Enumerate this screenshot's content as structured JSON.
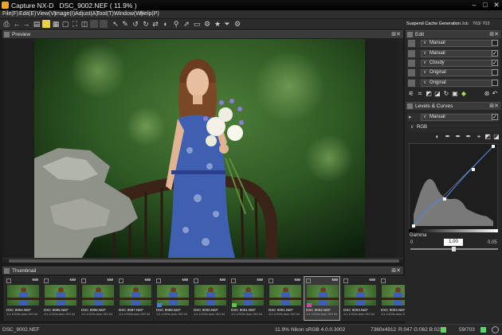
{
  "app": {
    "name": "Capture NX-D",
    "file_title": "DSC_9002.NEF ( 11.9% )"
  },
  "menu": [
    "File(F)",
    "Edit(E)",
    "View(V)",
    "Image(I)",
    "Adjust(A)",
    "Tool(T)",
    "Window(W)",
    "Help(P)"
  ],
  "job_tabs": {
    "active": "Suspend Cache Generation",
    "job": "Job",
    "count": "703/ 703"
  },
  "panels": {
    "preview": "Preview",
    "thumbnail": "Thumbnail",
    "edit": "Edit",
    "levels": "Levels & Curves"
  },
  "edit_rows": [
    {
      "icon": "picture-control-icon",
      "value": "Manual",
      "checked": false
    },
    {
      "icon": "exposure-icon",
      "value": "Manual",
      "checked": true
    },
    {
      "icon": "white-balance-icon",
      "value": "Cloudy",
      "checked": true
    },
    {
      "icon": "tone-icon",
      "value": "Original",
      "checked": false
    },
    {
      "icon": "lens-icon",
      "value": "Original",
      "checked": false
    }
  ],
  "levels": {
    "mode": "Manual",
    "channel": "RGB",
    "gamma_label": "Gamma",
    "gamma_value": "1.00",
    "black_point": "0",
    "white_point": "0.05"
  },
  "thumbnails": [
    {
      "name": "DSC 8994.NEF",
      "info": "1/1:1/320s Auto ISO 64",
      "label": "",
      "selected": false
    },
    {
      "name": "DSC 8995.NEF",
      "info": "1/1:1/320s Auto ISO 64",
      "label": "",
      "selected": false
    },
    {
      "name": "DSC 8996.NEF",
      "info": "1/1:1/320s Auto ISO 64",
      "label": "",
      "selected": false
    },
    {
      "name": "DSC 8997.NEF",
      "info": "1/1:1/320s Auto ISO 64",
      "label": "",
      "selected": false
    },
    {
      "name": "DSC 8998.NEF",
      "info": "1/1:1/320s Auto ISO 64",
      "label": "#4a7fd1",
      "selected": false
    },
    {
      "name": "DSC 9000.NEF",
      "info": "1/1:1/320s Auto ISO 64",
      "label": "",
      "selected": false
    },
    {
      "name": "DSC 9001.NEF",
      "info": "1/1:1/320s Auto ISO 64",
      "label": "#62c23b",
      "selected": false
    },
    {
      "name": "DSC 9001.NEF",
      "info": "1/1:1/320s Auto ISO 64",
      "label": "",
      "selected": false
    },
    {
      "name": "DSC 9002.NEF",
      "info": "1/1:1/320s Auto ISO 64",
      "label": "#d24aa0",
      "selected": true
    },
    {
      "name": "DSC 9003.NEF",
      "info": "1/1:1/320s Auto ISO 64",
      "label": "",
      "selected": false
    },
    {
      "name": "DSC 9004.NEF",
      "info": "1/1:1/320s Auto ISO 64",
      "label": "",
      "selected": false
    }
  ],
  "status": {
    "filename": "DSC_9002.NEF",
    "zoom": "11.9%",
    "profile": "Nikon sRGB 4.0.0.3002",
    "dimensions": "7360x4912",
    "rgb": "R:047 G:062 B:023",
    "page": "59/703"
  },
  "thumb_badge": "NW"
}
